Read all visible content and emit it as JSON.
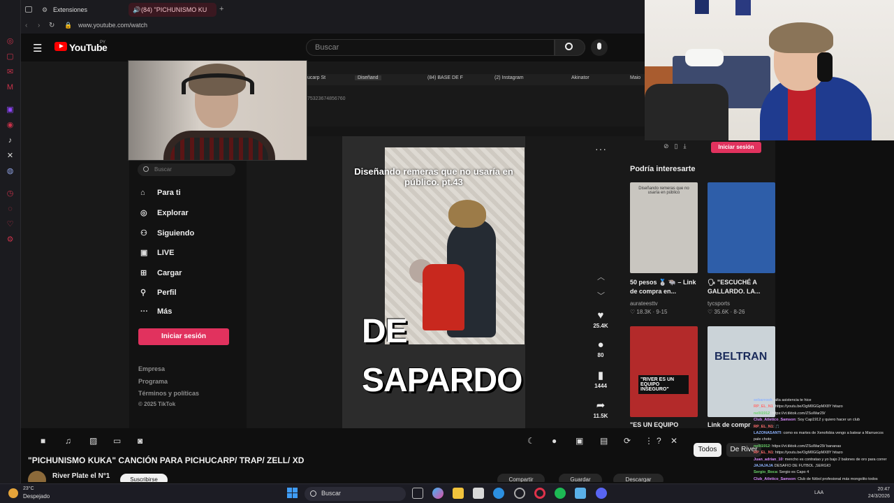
{
  "browser": {
    "tabs": [
      {
        "label": "Extensiones",
        "active": false
      },
      {
        "label": "(84) \"PICHUNISMO KU",
        "active": true
      }
    ],
    "url": "www.youtube.com/watch"
  },
  "youtube": {
    "brand": "YouTube",
    "country": "PY",
    "search_placeholder": "Buscar"
  },
  "tiktok_browser": {
    "tabs": [
      "ucarp St",
      "Diseñand",
      "(84) BASE DE F",
      "(2) Instagram",
      "Akinator",
      "Maio"
    ],
    "url_fragment": "75323674856760"
  },
  "tiktok": {
    "search_placeholder": "Buscar",
    "nav": [
      {
        "icon": "home-icon",
        "label": "Para ti"
      },
      {
        "icon": "compass-icon",
        "label": "Explorar"
      },
      {
        "icon": "following-icon",
        "label": "Siguiendo"
      },
      {
        "icon": "live-icon",
        "label": "LIVE"
      },
      {
        "icon": "upload-icon",
        "label": "Cargar"
      },
      {
        "icon": "profile-icon",
        "label": "Perfil"
      },
      {
        "icon": "more-icon",
        "label": "Más"
      }
    ],
    "login_label": "Iniciar sesión",
    "footer": [
      "Empresa",
      "Programa",
      "Términos y políticas",
      "© 2025 TikTok"
    ],
    "video_overlay": "Diseñando remeras que no usaría en público. pt.43",
    "big_text_line1": "DE",
    "big_text_line2": "SAPARDO",
    "actions": [
      {
        "icon": "heart-icon",
        "count": "25.4K"
      },
      {
        "icon": "comment-icon",
        "count": "80"
      },
      {
        "icon": "bookmark-icon",
        "count": "1444"
      },
      {
        "icon": "share-icon",
        "count": "11.5K"
      }
    ],
    "right_login": "Iniciar sesión",
    "rec_title": "Podría interesarte",
    "recommendations": [
      {
        "caption": "50 pesos 🥈 🐃 – Link de compra en...",
        "author": "aurateesttv",
        "meta": "♡ 18.3K · 9-15",
        "color": "#c9c6c0"
      },
      {
        "caption": "🗣 \"ESCUCHÉ A GALLARDO. LA...",
        "author": "tycsports",
        "meta": "♡ 35.6K · 8-26",
        "color": "#2e5ea9"
      },
      {
        "caption": "\"ES UN EQUIPO",
        "author": "",
        "meta": "",
        "color": "#b32a2a"
      },
      {
        "caption": "Link de compr",
        "author": "",
        "meta": "",
        "color": "#cbd3d8"
      }
    ],
    "rec_thumb_texts": [
      "Diseñando remeras que no usaría en público",
      "",
      "\"RIVER ES UN EQUIPO INSEGURO\"",
      "BELTRAN"
    ]
  },
  "player": {
    "chips": [
      "Todos",
      "De River"
    ]
  },
  "video": {
    "title": "\"PICHUNISMO KUKA\" CANCIÓN PARA PICHUCARP/ TRAP/ ZELL/ XD",
    "channel": "River Plate el N°1",
    "subscribe": "Suscribirse",
    "actions": [
      "Compartir",
      "Guardar",
      "Descargar"
    ]
  },
  "chat": [
    {
      "user": "sebarrooh",
      "text": ": alta asistencia te hice",
      "cls": ""
    },
    {
      "user": "RP_EL_N1",
      "text": ": https://youtu.be/OgM0GGpMX8Y hitazo",
      "cls": "r"
    },
    {
      "user": "nelli1912",
      "text": ": https://vt.tiktok.com/ZSuWar29/",
      "cls": "g"
    },
    {
      "user": "Club_Atletico_Samson",
      "text": ": Soy Cap1912 y quiero hacer un club",
      "cls": "p"
    },
    {
      "user": "RP_EL_N1",
      "text": ": 🎵",
      "cls": "r"
    },
    {
      "user": "LAZONASANTI",
      "text": ": como es martes de Xenofobia vengo a batear a Marruecos",
      "cls": ""
    },
    {
      "user": "",
      "text": "pale choto",
      "cls": ""
    },
    {
      "user": "nelli1912",
      "text": ": https://vt.tiktok.com/ZSuWar29/ bananas",
      "cls": "g"
    },
    {
      "user": "RP_EL_N1",
      "text": ": https://youtu.be/OgM0GGpMX8Y hitazo",
      "cls": "r"
    },
    {
      "user": "Juan_adrian_10",
      "text": ": mencho es contratao y yo bajo 2 balones de oro para correr",
      "cls": "p"
    },
    {
      "user": "JAJAJAJA",
      "text": " DESAFÍO DE FUTBOL ,SERGIO",
      "cls": ""
    },
    {
      "user": "Sergio_Boca",
      "text": ": Sergio es Capo 4",
      "cls": "g"
    },
    {
      "user": "Club_Atletico_Samson",
      "text": ": Club de fútbol profesional más mongolito todos",
      "cls": "p"
    },
    {
      "user": "RP_EL_N1",
      "text": ": 🎵",
      "cls": "r"
    },
    {
      "user": "sebarrooh",
      "text": ": 🎵",
      "cls": ""
    }
  ],
  "taskbar": {
    "temp": "23°C",
    "weather": "Despejado",
    "search_label": "Buscar",
    "time": "20:47",
    "date": "24/3/2026",
    "lang": "LAA"
  }
}
